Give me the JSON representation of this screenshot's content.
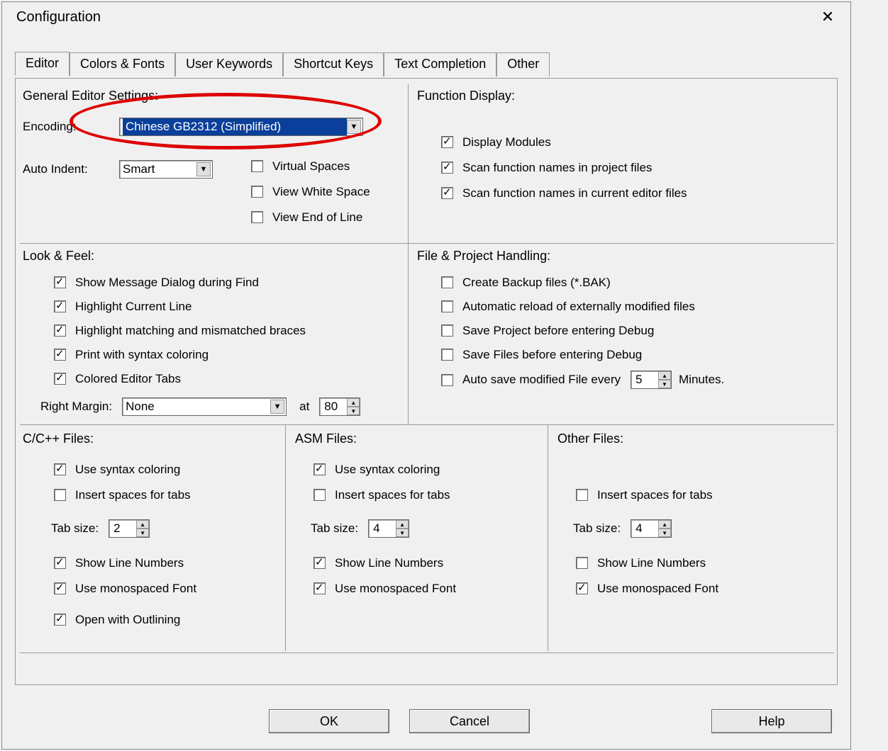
{
  "window": {
    "title": "Configuration"
  },
  "tabs": [
    "Editor",
    "Colors & Fonts",
    "User Keywords",
    "Shortcut Keys",
    "Text Completion",
    "Other"
  ],
  "general": {
    "heading": "General Editor Settings:",
    "encoding_label": "Encoding:",
    "encoding_value": "Chinese GB2312 (Simplified)",
    "autoindent_label": "Auto Indent:",
    "autoindent_value": "Smart",
    "virtual_spaces": "Virtual Spaces",
    "view_whitespace": "View White Space",
    "view_eol": "View End of Line"
  },
  "func": {
    "heading": "Function Display:",
    "display_modules": "Display Modules",
    "scan_project": "Scan function names in project files",
    "scan_editor": "Scan function names in current editor files"
  },
  "look": {
    "heading": "Look & Feel:",
    "show_msg": "Show Message Dialog during Find",
    "hl_line": "Highlight Current Line",
    "hl_braces": "Highlight matching and mismatched braces",
    "print_syntax": "Print with syntax coloring",
    "colored_tabs": "Colored Editor Tabs",
    "right_margin_label": "Right Margin:",
    "right_margin_value": "None",
    "at_label": "at",
    "margin_at": "80"
  },
  "file": {
    "heading": "File & Project Handling:",
    "backup": "Create Backup files (*.BAK)",
    "autoreload": "Automatic reload of externally modified files",
    "save_project": "Save Project before entering Debug",
    "save_files": "Save Files before entering Debug",
    "autosave": "Auto save modified File every",
    "autosave_value": "5",
    "minutes": "Minutes."
  },
  "cpp": {
    "heading": "C/C++ Files:",
    "syntax": "Use syntax coloring",
    "spaces": "Insert spaces for tabs",
    "tab_label": "Tab size:",
    "tab_value": "2",
    "lineno": "Show Line Numbers",
    "mono": "Use monospaced Font",
    "outline": "Open with Outlining"
  },
  "asm": {
    "heading": "ASM Files:",
    "syntax": "Use syntax coloring",
    "spaces": "Insert spaces for tabs",
    "tab_label": "Tab size:",
    "tab_value": "4",
    "lineno": "Show Line Numbers",
    "mono": "Use monospaced Font"
  },
  "other": {
    "heading": "Other Files:",
    "spaces": "Insert spaces for tabs",
    "tab_label": "Tab size:",
    "tab_value": "4",
    "lineno": "Show Line Numbers",
    "mono": "Use monospaced Font"
  },
  "buttons": {
    "ok": "OK",
    "cancel": "Cancel",
    "help": "Help"
  }
}
